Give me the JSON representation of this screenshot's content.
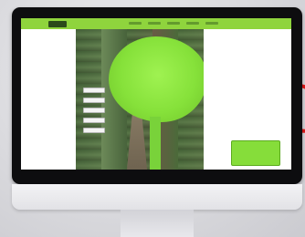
{
  "scene": {
    "description_colors": {
      "background": "#d9d9dd",
      "monitor_bezel": "#0d0d0f",
      "cable": "#e01818",
      "brand_green": "#8fd43d",
      "tree_green": "#86e13a"
    }
  },
  "website": {
    "nav": {
      "logo_icon": "logo-icon",
      "items": [
        "",
        "",
        "",
        "",
        ""
      ]
    },
    "hero": {
      "image_icon": "tree-icon"
    },
    "side_menu": {
      "items": [
        "",
        "",
        "",
        "",
        ""
      ]
    },
    "cta": {
      "label": ""
    }
  }
}
